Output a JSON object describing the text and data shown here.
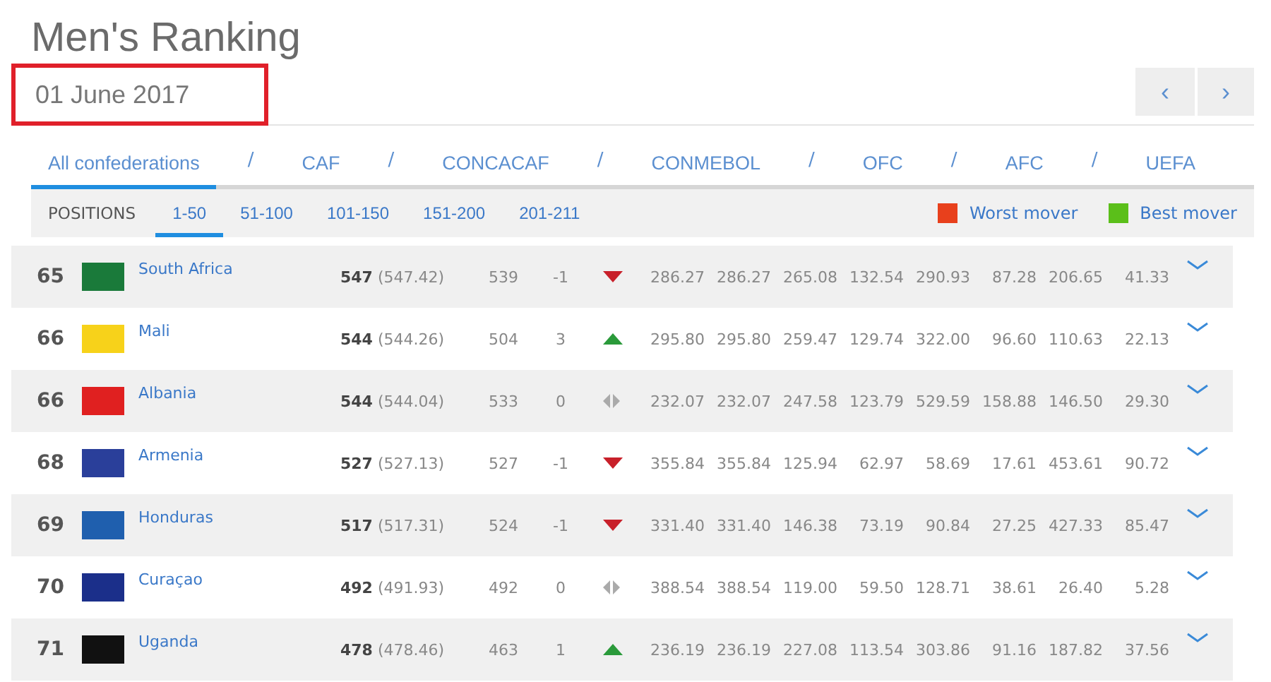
{
  "page": {
    "title": "Men's Ranking",
    "date": "01 June 2017",
    "date_highlighted": true
  },
  "pager": {
    "prev": "‹",
    "next": "›"
  },
  "confederation_tabs": [
    {
      "label": "All confederations",
      "selected": true
    },
    {
      "label": "CAF",
      "selected": false
    },
    {
      "label": "CONCACAF",
      "selected": false
    },
    {
      "label": "CONMEBOL",
      "selected": false
    },
    {
      "label": "OFC",
      "selected": false
    },
    {
      "label": "AFC",
      "selected": false
    },
    {
      "label": "UEFA",
      "selected": false
    }
  ],
  "tab_separator": "/",
  "positions": {
    "label": "POSITIONS",
    "ranges": [
      {
        "label": "1-50",
        "selected": true
      },
      {
        "label": "51-100",
        "selected": false
      },
      {
        "label": "101-150",
        "selected": false
      },
      {
        "label": "151-200",
        "selected": false
      },
      {
        "label": "201-211",
        "selected": false
      }
    ]
  },
  "legend": [
    {
      "label": "Worst mover",
      "color": "#e8401c"
    },
    {
      "label": "Best mover",
      "color": "#5bbf1a"
    }
  ],
  "rows": [
    {
      "rank": "65",
      "color": "#1a7a3a",
      "team": "South Africa",
      "points": "**547** (547.42)",
      "previous": "539",
      "change": "-1",
      "kind": "down",
      "values": [
        "286.27",
        "286.27",
        "265.08",
        "132.54",
        "290.93",
        "87.28",
        "206.65",
        "41.33"
      ]
    },
    {
      "rank": "66",
      "color": "#f7d21a",
      "team": "Mali",
      "points": "**544** (544.26)",
      "previous": "504",
      "change": "3",
      "kind": "up",
      "values": [
        "295.80",
        "295.80",
        "259.47",
        "129.74",
        "322.00",
        "96.60",
        "110.63",
        "22.13"
      ]
    },
    {
      "rank": "66",
      "color": "#e02020",
      "team": "Albania",
      "points": "**544** (544.04)",
      "previous": "533",
      "change": "0",
      "kind": "same",
      "values": [
        "232.07",
        "232.07",
        "247.58",
        "123.79",
        "529.59",
        "158.88",
        "146.50",
        "29.30"
      ]
    },
    {
      "rank": "68",
      "color": "#2a3f9a",
      "team": "Armenia",
      "points": "**527** (527.13)",
      "previous": "527",
      "change": "-1",
      "kind": "down",
      "values": [
        "355.84",
        "355.84",
        "125.94",
        "62.97",
        "58.69",
        "17.61",
        "453.61",
        "90.72"
      ]
    },
    {
      "rank": "69",
      "color": "#1f5fae",
      "team": "Honduras",
      "points": "**517** (517.31)",
      "previous": "524",
      "change": "-1",
      "kind": "down",
      "values": [
        "331.40",
        "331.40",
        "146.38",
        "73.19",
        "90.84",
        "27.25",
        "427.33",
        "85.47"
      ]
    },
    {
      "rank": "70",
      "color": "#1b2f8a",
      "team": "Curaçao",
      "points": "**492** (491.93)",
      "previous": "492",
      "change": "0",
      "kind": "same",
      "values": [
        "388.54",
        "388.54",
        "119.00",
        "59.50",
        "128.71",
        "38.61",
        "26.40",
        "5.28"
      ]
    },
    {
      "rank": "71",
      "color": "#111111",
      "team": "Uganda",
      "points": "**478** (478.46)",
      "previous": "463",
      "change": "1",
      "kind": "up",
      "values": [
        "236.19",
        "236.19",
        "227.08",
        "113.54",
        "303.86",
        "91.16",
        "187.82",
        "37.56"
      ]
    }
  ]
}
